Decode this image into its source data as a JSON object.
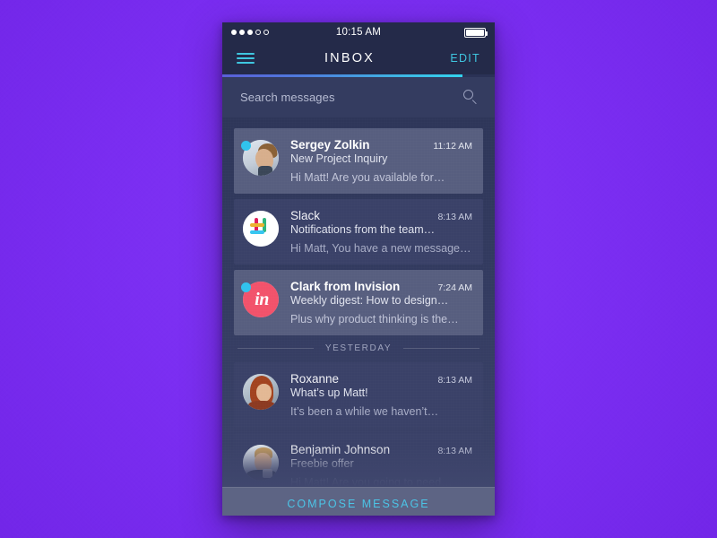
{
  "theme": {
    "page_background": "#7b2ef2",
    "phone_background": "#2c3455",
    "accent": "#3fc6e0",
    "unread_badge": "#31c3ee",
    "row_unread_bg": "#575e7f",
    "row_read_bg": "#3a4168",
    "compose_bg": "#5d6484"
  },
  "status_bar": {
    "signal_dots": [
      "on",
      "on",
      "on",
      "off",
      "off"
    ],
    "time": "10:15 AM",
    "battery_level": "100",
    "battery_icon": "battery-full-icon"
  },
  "nav": {
    "menu_icon": "hamburger-menu-icon",
    "title": "INBOX",
    "edit_label": "EDIT"
  },
  "progress": {
    "percent": "88"
  },
  "search": {
    "placeholder": "Search messages",
    "value": "",
    "icon": "search-icon"
  },
  "messages": [
    {
      "id": "sergey-zolkin",
      "sender": "Sergey Zolkin",
      "subject": "New Project Inquiry",
      "preview": "Hi Matt! Are you available for…",
      "time": "11:12 AM",
      "unread": true,
      "avatar_kind": "photo-man-profile"
    },
    {
      "id": "slack",
      "sender": "Slack",
      "subject": "Notifications from the team…",
      "preview": "Hi Matt, You have a new message…",
      "time": "8:13 AM",
      "unread": false,
      "avatar_kind": "slack-logo"
    },
    {
      "id": "clark-from-invision",
      "sender": "Clark from Invision",
      "subject": "Weekly digest: How to design…",
      "preview": "Plus why product thinking is the…",
      "time": "7:24 AM",
      "unread": true,
      "avatar_kind": "invision-logo"
    }
  ],
  "divider": {
    "label": "YESTERDAY"
  },
  "messages_yesterday": [
    {
      "id": "roxanne",
      "sender": "Roxanne",
      "subject": "What’s up Matt!",
      "preview": "It’s been a while we haven’t…",
      "time": "8:13 AM",
      "unread": false,
      "avatar_kind": "photo-woman-redhair"
    },
    {
      "id": "benjamin-johnson",
      "sender": "Benjamin Johnson",
      "subject": "Freebie offer",
      "preview": "Hi Matt! Are you going to need…",
      "time": "8:13 AM",
      "unread": false,
      "avatar_kind": "photo-man-glasses"
    }
  ],
  "compose": {
    "label": "COMPOSE MESSAGE"
  },
  "invision_logo_text": "in"
}
